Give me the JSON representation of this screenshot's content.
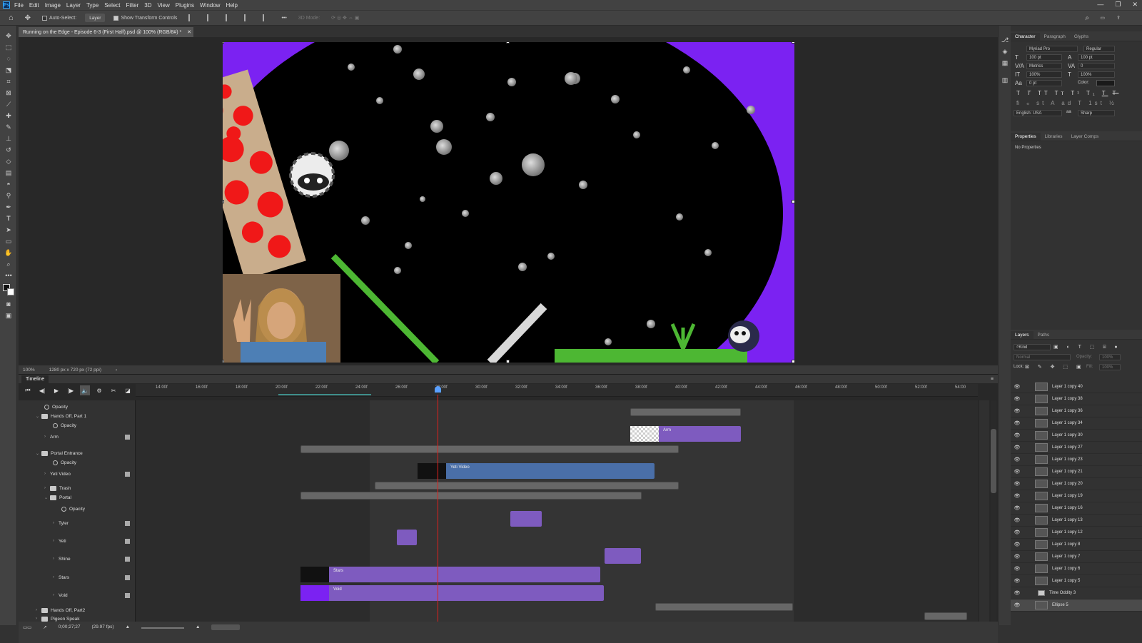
{
  "app": {
    "logo": "Ps"
  },
  "menu": [
    "File",
    "Edit",
    "Image",
    "Layer",
    "Type",
    "Select",
    "Filter",
    "3D",
    "View",
    "Plugins",
    "Window",
    "Help"
  ],
  "options": {
    "auto_select": "Auto-Select:",
    "target": "Layer",
    "show_transform": "Show Transform Controls",
    "mode_3d": "3D Mode:"
  },
  "document": {
    "tab_title": "Running on the Edge - Episode 6-3 (First Half).psd @ 100% (RGB/8#) *",
    "zoom": "100%",
    "dims": "1280 px x 720 px (72 ppi)"
  },
  "character_panel": {
    "tabs": [
      "Character",
      "Paragraph",
      "Glyphs"
    ],
    "font": "Myriad Pro",
    "style": "Regular",
    "size": "100 pt",
    "leading": "100 pt",
    "kerning": "Metrics",
    "tracking": "0",
    "vscale": "100%",
    "hscale": "100%",
    "baseline": "0 pt",
    "color_label": "Color:",
    "language": "English: USA",
    "aa": "Sharp"
  },
  "properties_panel": {
    "tabs": [
      "Properties",
      "Libraries",
      "Layer Comps"
    ],
    "empty": "No Properties"
  },
  "layers_panel": {
    "tabs": [
      "Layers",
      "Paths"
    ],
    "filter": "Kind",
    "blend": "Normal",
    "opacity_label": "Opacity:",
    "opacity": "100%",
    "lock_label": "Lock:",
    "fill_label": "Fill:",
    "fill": "100%",
    "layers": [
      "Layer 1 copy 40",
      "Layer 1 copy 38",
      "Layer 1 copy 36",
      "Layer 1 copy 34",
      "Layer 1 copy 30",
      "Layer 1 copy 27",
      "Layer 1 copy 23",
      "Layer 1 copy 21",
      "Layer 1 copy 20",
      "Layer 1 copy 19",
      "Layer 1 copy 16",
      "Layer 1 copy 13",
      "Layer 1 copy 12",
      "Layer 1 copy 8",
      "Layer 1 copy 7",
      "Layer 1 copy 6",
      "Layer 1 copy 5",
      "Time Oddity 3",
      "Ellipse 5"
    ]
  },
  "timeline": {
    "title": "Timeline",
    "ruler": [
      "14:00f",
      "16:00f",
      "18:00f",
      "20:00f",
      "22:00f",
      "24:00f",
      "26:00f",
      "28:00f",
      "30:00f",
      "32:00f",
      "34:00f",
      "36:00f",
      "38:00f",
      "40:00f",
      "42:00f",
      "44:00f",
      "46:00f",
      "48:00f",
      "50:00f",
      "52:00f",
      "54:00"
    ],
    "rows": [
      {
        "label": "Opacity",
        "kind": "prop",
        "indent": 1
      },
      {
        "label": "Hands Off, Part 1",
        "kind": "group",
        "indent": 0
      },
      {
        "label": "Opacity",
        "kind": "prop",
        "indent": 2
      },
      {
        "label": "Arm",
        "kind": "layer",
        "indent": 1
      },
      {
        "label": "Portal Entrance",
        "kind": "group",
        "indent": 0
      },
      {
        "label": "Opacity",
        "kind": "prop",
        "indent": 2
      },
      {
        "label": "Yeti Video",
        "kind": "layer",
        "indent": 1
      },
      {
        "label": "Trash",
        "kind": "group",
        "indent": 1
      },
      {
        "label": "Portal",
        "kind": "group",
        "indent": 1
      },
      {
        "label": "Opacity",
        "kind": "prop",
        "indent": 3
      },
      {
        "label": "Tyler",
        "kind": "layer",
        "indent": 2
      },
      {
        "label": "Yeti",
        "kind": "layer",
        "indent": 2
      },
      {
        "label": "Shine",
        "kind": "layer",
        "indent": 2
      },
      {
        "label": "Stars",
        "kind": "layer",
        "indent": 2
      },
      {
        "label": "Void",
        "kind": "layer",
        "indent": 2
      },
      {
        "label": "Hands Off, Part2",
        "kind": "group",
        "indent": 0
      },
      {
        "label": "Pigeon Speak",
        "kind": "group",
        "indent": 0
      }
    ],
    "clips": {
      "arm": "Arm",
      "yeti_video": "Yeti Video",
      "stars": "Stars",
      "void": "Void"
    },
    "timecode": "0;00;27;27",
    "fps": "(29.97 fps)"
  },
  "colors": {
    "accent": "#31a8ff",
    "clip_purple": "#7e5bbf",
    "clip_blue": "#4a6fa8",
    "playhead": "#e0211d",
    "portal": "#7b22f2"
  }
}
